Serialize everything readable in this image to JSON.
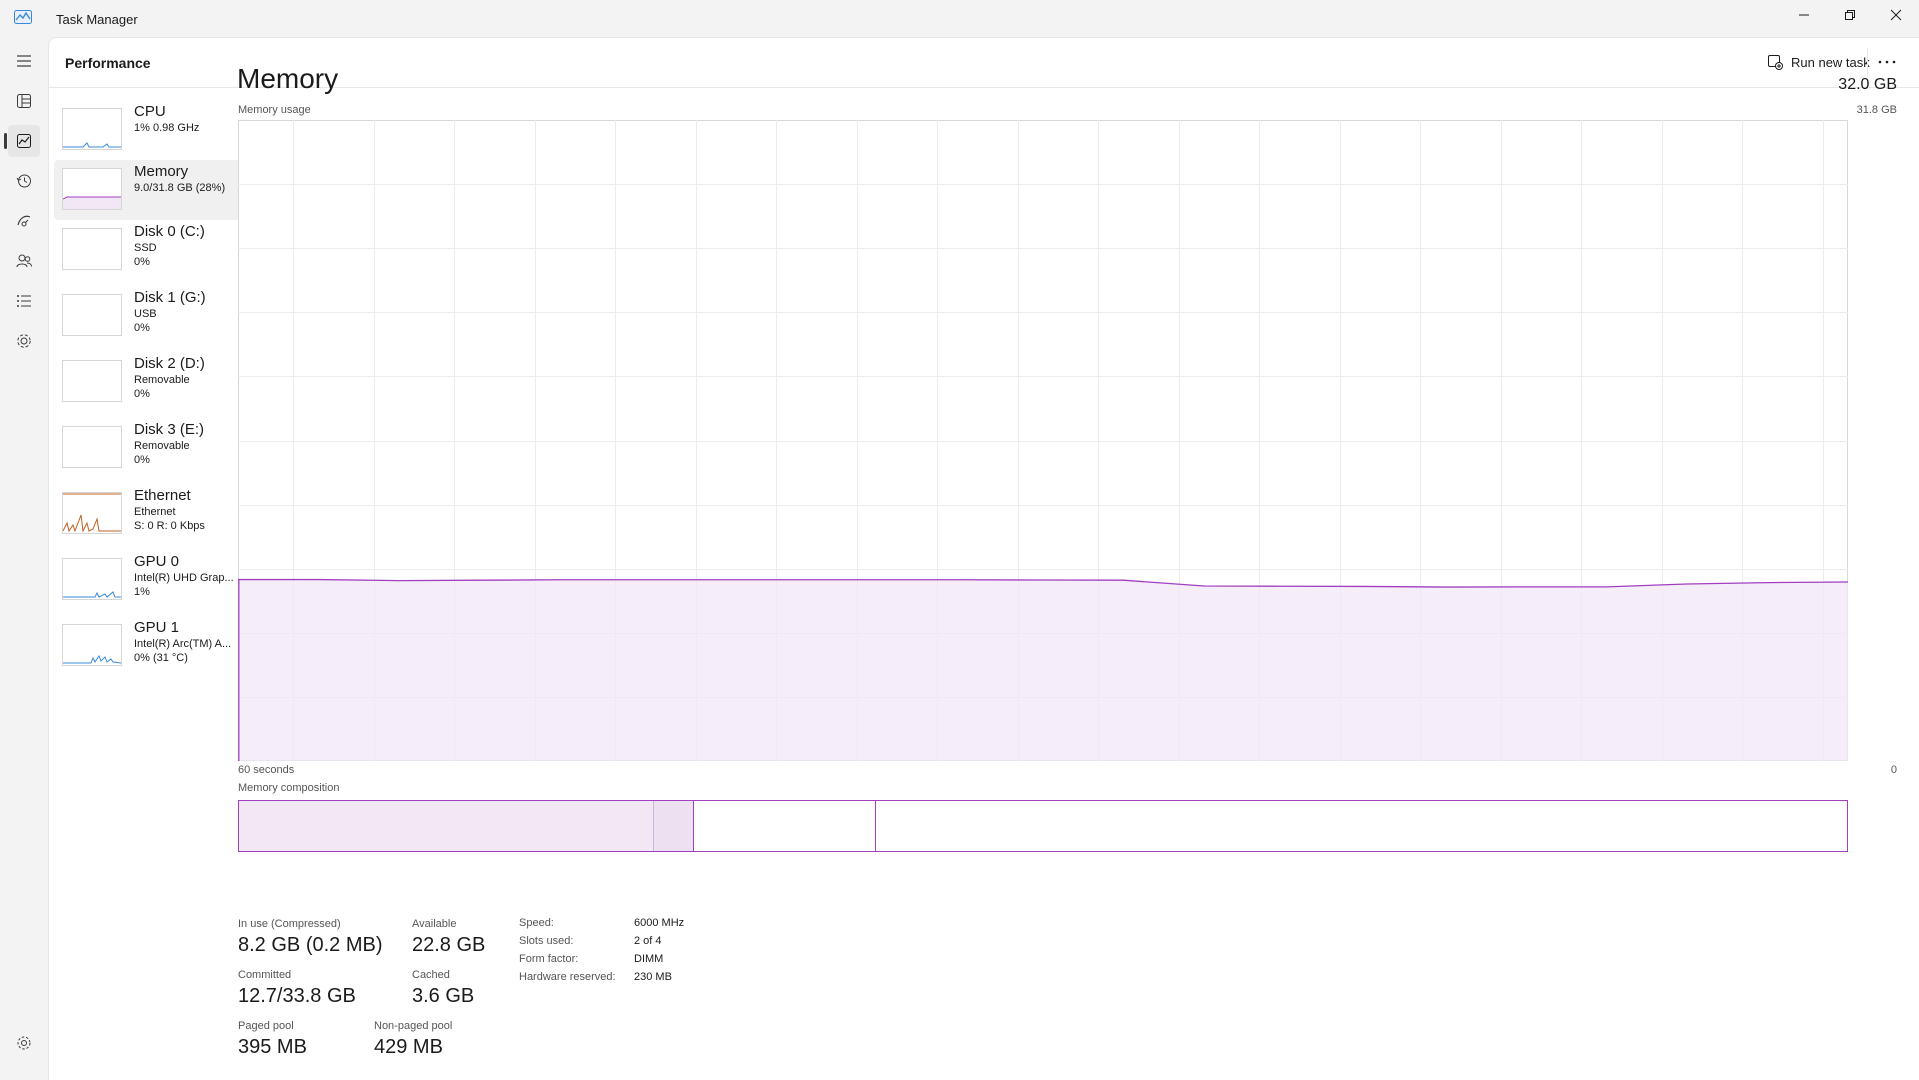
{
  "window": {
    "title": "Task Manager"
  },
  "rail": {
    "items": [
      {
        "icon": "hamburger-menu-icon"
      },
      {
        "icon": "processes-icon"
      },
      {
        "icon": "performance-icon"
      },
      {
        "icon": "app-history-icon"
      },
      {
        "icon": "startup-apps-icon"
      },
      {
        "icon": "users-icon"
      },
      {
        "icon": "details-icon"
      },
      {
        "icon": "services-icon"
      },
      {
        "icon": "settings-icon"
      }
    ]
  },
  "header": {
    "title": "Performance",
    "run_new_task": "Run new task",
    "more_icon": "more-options-icon"
  },
  "devices": [
    {
      "name": "CPU",
      "sub1": "1% 0.98 GHz",
      "sub2": "",
      "color": "#3b8ad9"
    },
    {
      "name": "Memory",
      "sub1": "9.0/31.8 GB (28%)",
      "sub2": "",
      "color": "#a23ec0"
    },
    {
      "name": "Disk 0 (C:)",
      "sub1": "SSD",
      "sub2": "0%",
      "color": "#4caf50"
    },
    {
      "name": "Disk 1 (G:)",
      "sub1": "USB",
      "sub2": "0%",
      "color": "#4caf50"
    },
    {
      "name": "Disk 2 (D:)",
      "sub1": "Removable",
      "sub2": "0%",
      "color": "#4caf50"
    },
    {
      "name": "Disk 3 (E:)",
      "sub1": "Removable",
      "sub2": "0%",
      "color": "#4caf50"
    },
    {
      "name": "Ethernet",
      "sub1": "Ethernet",
      "sub2": "S: 0 R: 0 Kbps",
      "color": "#c06020"
    },
    {
      "name": "GPU 0",
      "sub1": "Intel(R) UHD Grap...",
      "sub2": "1%",
      "color": "#3b8ad9"
    },
    {
      "name": "GPU 1",
      "sub1": "Intel(R) Arc(TM) A...",
      "sub2": "0% (31 °C)",
      "color": "#3b8ad9"
    }
  ],
  "memory": {
    "title": "Memory",
    "total": "32.0 GB",
    "usage_label": "Memory usage",
    "usage_max": "31.8 GB",
    "axis_left": "60 seconds",
    "axis_right": "0",
    "composition_label": "Memory composition",
    "accent_color": "#a23ec0",
    "fill_color": "#f1e7f5",
    "composition": {
      "in_use_gb": 8.2,
      "modified_gb": 0.8,
      "standby_gb": 3.6,
      "free_gb": 19.2
    }
  },
  "chart_data": {
    "type": "area",
    "title": "",
    "xlabel": "",
    "ylabel": "",
    "xlim": [
      60,
      0
    ],
    "ylim": [
      0,
      31.8
    ],
    "x": [
      60,
      57,
      54,
      51,
      48,
      45,
      42,
      39,
      36,
      33,
      30,
      27,
      24,
      21,
      18,
      15,
      12,
      9,
      6,
      3,
      0
    ],
    "series": [
      {
        "values": [
          9.0,
          9.0,
          8.95,
          8.97,
          8.99,
          8.99,
          8.99,
          8.99,
          8.99,
          8.99,
          8.98,
          8.97,
          8.68,
          8.67,
          8.66,
          8.63,
          8.64,
          8.64,
          8.78,
          8.85,
          8.88
        ]
      }
    ],
    "grid": true
  },
  "stats": {
    "in_use_label": "In use (Compressed)",
    "in_use_value": "8.2 GB (0.2 MB)",
    "available_label": "Available",
    "available_value": "22.8 GB",
    "committed_label": "Committed",
    "committed_value": "12.7/33.8 GB",
    "cached_label": "Cached",
    "cached_value": "3.6 GB",
    "paged_label": "Paged pool",
    "paged_value": "395 MB",
    "nonpaged_label": "Non-paged pool",
    "nonpaged_value": "429 MB"
  },
  "specs": {
    "speed_label": "Speed:",
    "speed_value": "6000 MHz",
    "slots_label": "Slots used:",
    "slots_value": "2 of 4",
    "form_label": "Form factor:",
    "form_value": "DIMM",
    "reserved_label": "Hardware reserved:",
    "reserved_value": "230 MB"
  }
}
